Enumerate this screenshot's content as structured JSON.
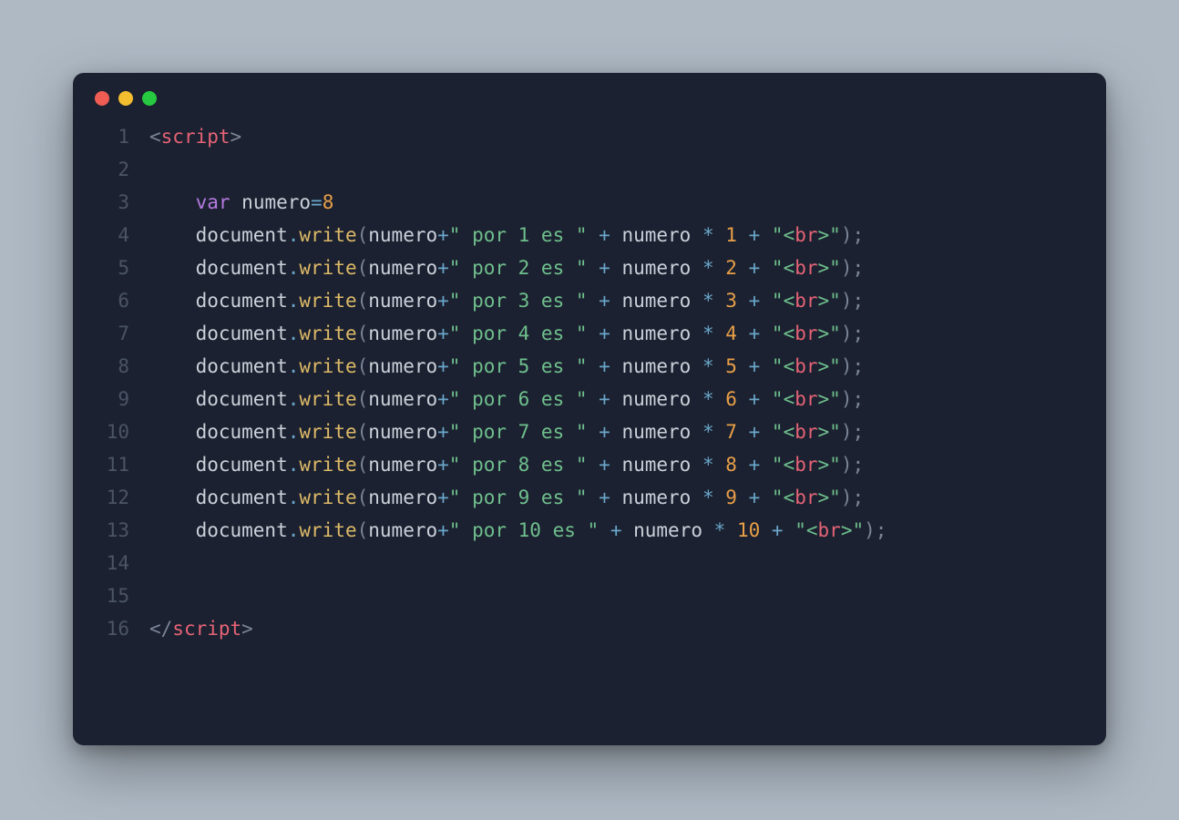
{
  "window": {
    "dots": {
      "close_color": "#ee5c54",
      "minimize_color": "#f2bd2e",
      "maximize_color": "#26c940"
    }
  },
  "code": {
    "total_lines": 16,
    "indent": "    ",
    "indent2": "        ",
    "open_tag": {
      "lt": "<",
      "name": "script",
      "gt": ">"
    },
    "close_tag": {
      "lt": "</",
      "name": "script",
      "gt": ">"
    },
    "var_line": {
      "kw": "var",
      "sp1": " ",
      "ident": "numero",
      "eq": "=",
      "val": "8"
    },
    "call": {
      "obj": "document",
      "dot": ".",
      "method": "write",
      "open": "(",
      "arg1": "numero",
      "plus": "+",
      "str_pre": "\" por ",
      "str_post": " es \"",
      "sp": " ",
      "mul": "*",
      "str_br_l": "\"<",
      "str_br_name": "br",
      "str_br_r": ">\"",
      "close": ")",
      "semi": ";"
    },
    "rows": [
      {
        "n": "1"
      },
      {
        "n": "2"
      },
      {
        "n": "3"
      },
      {
        "n": "4"
      },
      {
        "n": "5"
      },
      {
        "n": "6"
      },
      {
        "n": "7"
      },
      {
        "n": "8"
      },
      {
        "n": "9"
      },
      {
        "n": "10"
      }
    ]
  }
}
